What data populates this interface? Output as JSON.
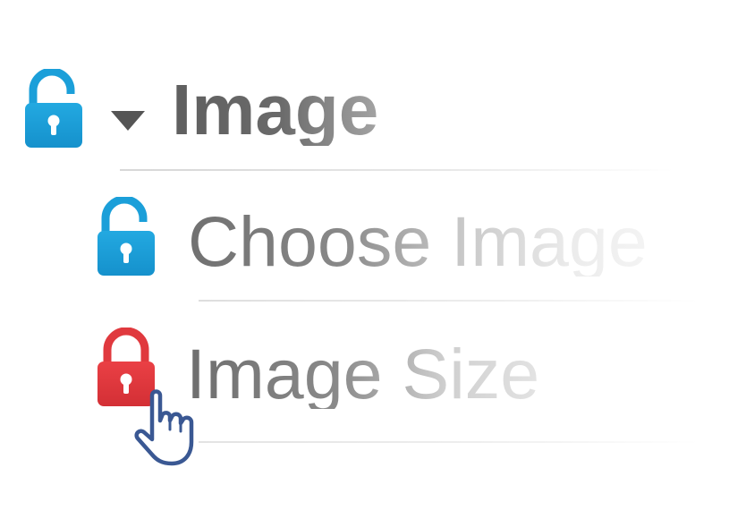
{
  "menu": {
    "items": [
      {
        "label": "Image",
        "lock_state": "unlocked",
        "lock_icon": "unlocked-padlock-icon",
        "expander_icon": "caret-down-icon",
        "expanded": true
      },
      {
        "label": "Choose Image",
        "lock_state": "unlocked",
        "lock_icon": "unlocked-padlock-icon"
      },
      {
        "label": "Image Size",
        "lock_state": "locked",
        "lock_icon": "locked-padlock-icon"
      }
    ]
  },
  "cursor": {
    "icon": "hand-pointer-icon"
  },
  "colors": {
    "unlocked": "#1a9ad6",
    "locked": "#e0393e",
    "cursor_outline": "#3a5893",
    "text": "#6a6a6a"
  }
}
